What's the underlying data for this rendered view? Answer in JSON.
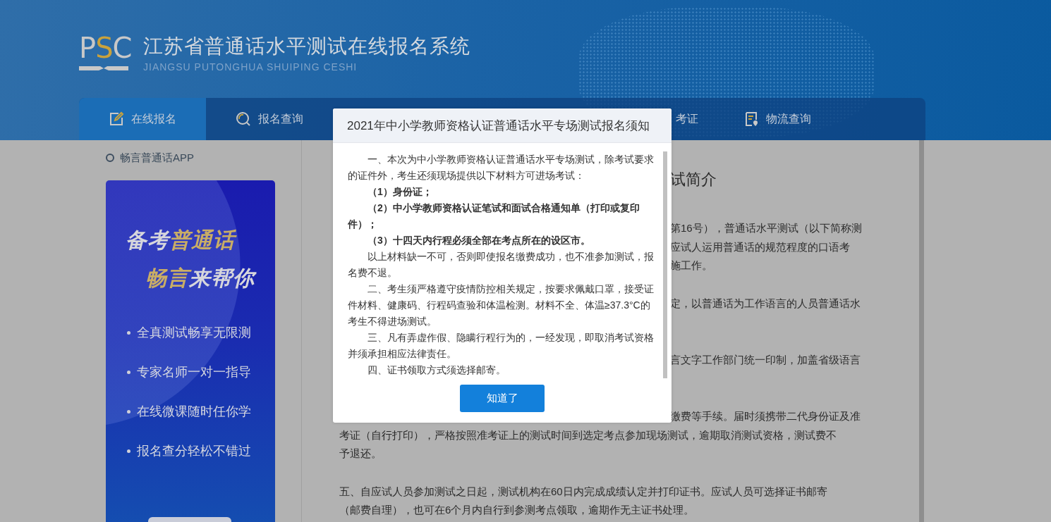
{
  "header": {
    "logo": "PSC",
    "title": "江苏省普通话水平测试在线报名系统",
    "subtitle": "JIANGSU PUTONGHUA SHUIPING CESHI"
  },
  "nav": {
    "tabs": [
      {
        "label": "在线报名",
        "kind": "edit",
        "selected": true
      },
      {
        "label": "报名查询",
        "kind": "search",
        "selected": false
      },
      {
        "label": "考证",
        "kind": "partial",
        "selected": false
      },
      {
        "label": "物流查询",
        "kind": "document",
        "selected": false
      }
    ]
  },
  "sidebar": {
    "heading": "畅言普通话APP",
    "banner": {
      "slogan": [
        [
          {
            "text": "备考",
            "accent": false
          },
          {
            "text": "普通话",
            "accent": true
          }
        ],
        [
          {
            "text": "畅言",
            "accent": true
          },
          {
            "text": "来帮你",
            "accent": false
          }
        ]
      ],
      "features": [
        "全真测试畅享无限测",
        "专家名师一对一指导",
        "在线微课随时任你学",
        "报名查分轻松不错过"
      ]
    }
  },
  "content": {
    "title": "试简介",
    "paragraphs": [
      {
        "lines": [
          {
            "kind": "fragment",
            "text": "第16号），普通话水平测试（以下简称测"
          },
          {
            "kind": "fragment",
            "text": "应试人运用普通话的规范程度的口语考"
          },
          {
            "kind": "fragment",
            "text": "施工作。"
          }
        ]
      },
      {
        "lines": [
          {
            "kind": "fragment",
            "text": "定，以普通话为工作语言的人员普通话水"
          }
        ]
      },
      {
        "lines": [
          {
            "kind": "fragment",
            "text": "言文字工作部门统一印制，加盖省级语言"
          }
        ]
      },
      {
        "lines": [
          {
            "kind": "fragment",
            "text": "缴费等手续。届时须携带二代身份证及准"
          },
          {
            "kind": "full",
            "text": "考证（自行打印），严格按照准考证上的测试时间到选定考点参加现场测试，逾期取消测试资格，测试费不"
          },
          {
            "kind": "full",
            "text": "予退还。"
          }
        ]
      },
      {
        "lines": [
          {
            "kind": "full",
            "text": "五、自应试人员参加测试之日起，测试机构在60日内完成成绩认定并打印证书。应试人员可选择证书邮寄"
          },
          {
            "kind": "full",
            "text": "（邮费自理），也可在6个月内自行到参测考点领取，逾期作无主证书处理。"
          }
        ]
      }
    ]
  },
  "modal": {
    "title": "2021年中小学教师资格认证普通话水平专场测试报名须知",
    "paragraphs": [
      {
        "text": "一、本次为中小学教师资格认证普通话水平专场测试，除考试要求的证件外，考生还须现场提供以下材料方可进场考试：",
        "bold": false
      },
      {
        "text": "（1）身份证；",
        "bold": true
      },
      {
        "text": "（2）中小学教师资格认证笔试和面试合格通知单（打印或复印件）；",
        "bold": true
      },
      {
        "text": "（3）十四天内行程必须全部在考点所在的设区市。",
        "bold": true
      },
      {
        "text": "以上材料缺一不可，否则即使报名缴费成功，也不准参加测试，报名费不退。",
        "bold": false
      },
      {
        "text": "二、考生须严格遵守疫情防控相关规定，按要求佩戴口罩，接受证件材料、健康码、行程码查验和体温检测。材料不全、体温≥37.3°C的考生不得进场测试。",
        "bold": false
      },
      {
        "text": "三、凡有弄虚作假、隐瞒行程行为的，一经发现，即取消考试资格并须承担相应法律责任。",
        "bold": false
      },
      {
        "text": "四、证书领取方式须选择邮寄。",
        "bold": false
      }
    ],
    "button": "知道了"
  }
}
